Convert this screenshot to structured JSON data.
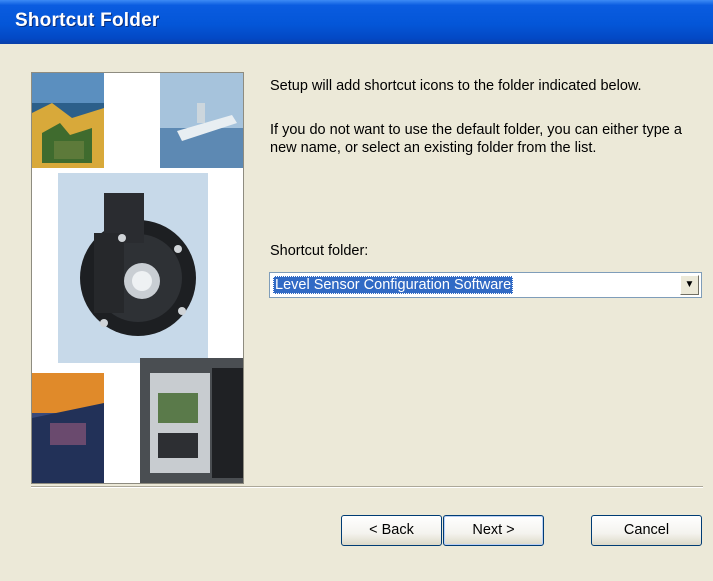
{
  "window": {
    "title": "Shortcut Folder"
  },
  "content": {
    "intro": "Setup will add shortcut icons to the folder indicated below.",
    "instructions": "If you do not want to use the default folder, you can either type a new name, or select an existing folder from the list.",
    "folder_label": "Shortcut folder:",
    "folder_value": "Level Sensor Configuration Software"
  },
  "buttons": {
    "back": "< Back",
    "next": "Next >",
    "cancel": "Cancel"
  },
  "icons": {
    "dropdown": "chevron-down-icon"
  },
  "colors": {
    "titlebar": "#0456d8",
    "dialog_bg": "#ece9d8",
    "selection": "#316ac5"
  }
}
